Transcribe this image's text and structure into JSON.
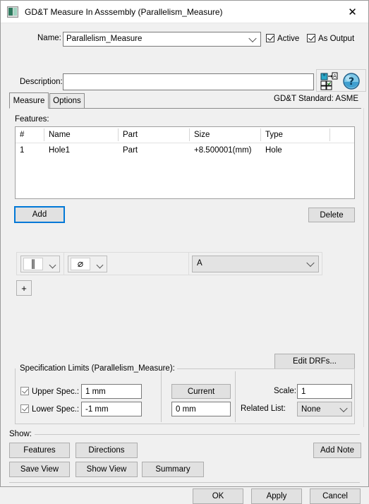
{
  "window": {
    "title": "GD&T Measure In Asssembly (Parallelism_Measure)",
    "icon": "measure-icon",
    "close_label": "✕"
  },
  "name_row": {
    "label": "Name:",
    "value": "Parallelism_Measure",
    "active_label": "Active",
    "active_checked": true,
    "as_output_label": "As Output",
    "as_output_checked": true
  },
  "description_row": {
    "label": "Description:",
    "value": "",
    "icons": [
      "mapping-icon",
      "help-icon"
    ]
  },
  "tabs": {
    "items": [
      {
        "label": "Measure",
        "selected": true
      },
      {
        "label": "Options",
        "selected": false
      }
    ],
    "standard_label": "GD&T Standard: ASME"
  },
  "features": {
    "label": "Features:",
    "columns": [
      "#",
      "Name",
      "Part",
      "Size",
      "Type",
      ""
    ],
    "rows": [
      {
        "num": "1",
        "name": "Hole1",
        "part": "Part",
        "size": "+8.500001(mm)",
        "type": "Hole"
      }
    ],
    "add_label": "Add",
    "delete_label": "Delete"
  },
  "fcf": {
    "symbol_primary": "∥",
    "symbol_primary_name": "parallelism-symbol",
    "symbol_modifier": "⌀",
    "symbol_modifier_name": "diameter-symbol",
    "datum_value": "A",
    "add_row_label": "+"
  },
  "drf": {
    "edit_label": "Edit DRFs..."
  },
  "spec_limits": {
    "group_title": "Specification Limits (Parallelism_Measure):",
    "upper_label": "Upper Spec.:",
    "upper_checked": true,
    "upper_value": "1 mm",
    "lower_label": "Lower Spec.:",
    "lower_checked": true,
    "lower_value": "-1 mm",
    "current_label": "Current",
    "current_value": "0 mm",
    "scale_label": "Scale:",
    "scale_value": "1",
    "related_list_label": "Related List:",
    "related_list_value": "None"
  },
  "show": {
    "group_title": "Show:",
    "features_label": "Features",
    "directions_label": "Directions",
    "add_note_label": "Add Note",
    "save_view_label": "Save View",
    "show_view_label": "Show View",
    "summary_label": "Summary"
  },
  "dialog_buttons": {
    "ok_label": "OK",
    "apply_label": "Apply",
    "cancel_label": "Cancel"
  },
  "colors": {
    "dialog_bg": "#f0f0f0",
    "titlebar_bg": "#ffffff",
    "button_bg": "#e1e1e1",
    "focus_blue": "#0078d7",
    "border": "#a0a0a0"
  }
}
